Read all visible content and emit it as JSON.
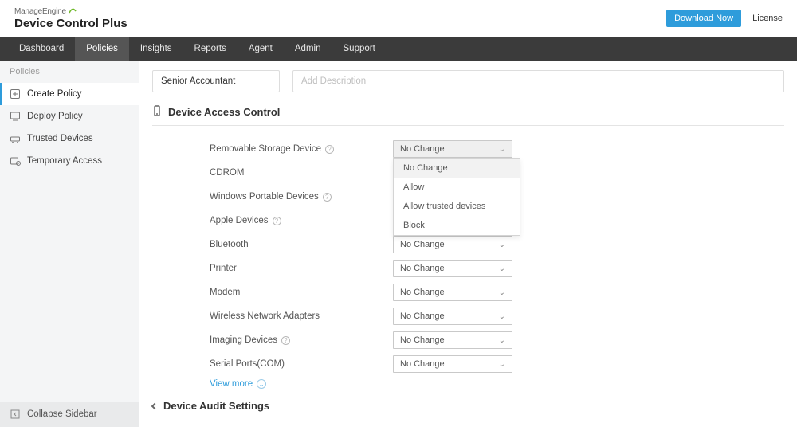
{
  "header": {
    "logo_small": "ManageEngine",
    "logo_big": "Device Control Plus",
    "download": "Download Now",
    "license": "License"
  },
  "nav": {
    "items": [
      {
        "label": "Dashboard"
      },
      {
        "label": "Policies",
        "active": true
      },
      {
        "label": "Insights"
      },
      {
        "label": "Reports"
      },
      {
        "label": "Agent"
      },
      {
        "label": "Admin"
      },
      {
        "label": "Support"
      }
    ]
  },
  "sidebar": {
    "header": "Policies",
    "items": [
      {
        "label": "Create Policy",
        "icon": "create",
        "active": true
      },
      {
        "label": "Deploy Policy",
        "icon": "deploy"
      },
      {
        "label": "Trusted Devices",
        "icon": "trusted"
      },
      {
        "label": "Temporary Access",
        "icon": "temp"
      }
    ],
    "collapse": "Collapse Sidebar"
  },
  "policy_form": {
    "name_value": "Senior Accountant",
    "desc_placeholder": "Add Description"
  },
  "section": {
    "access_control": "Device Access Control",
    "audit_settings": "Device Audit Settings"
  },
  "dropdown_open_index": 0,
  "dropdown_options": [
    "No Change",
    "Allow",
    "Allow trusted devices",
    "Block"
  ],
  "controls": [
    {
      "label": "Removable Storage Device",
      "help": true,
      "value": "No Change",
      "open": true
    },
    {
      "label": "CDROM",
      "value": ""
    },
    {
      "label": "Windows Portable Devices",
      "help": true,
      "value": ""
    },
    {
      "label": "Apple Devices",
      "help": true,
      "value": ""
    },
    {
      "label": "Bluetooth",
      "value": "No Change"
    },
    {
      "label": "Printer",
      "value": "No Change"
    },
    {
      "label": "Modem",
      "value": "No Change"
    },
    {
      "label": "Wireless Network Adapters",
      "value": "No Change"
    },
    {
      "label": "Imaging Devices",
      "help": true,
      "value": "No Change"
    },
    {
      "label": "Serial Ports(COM)",
      "value": "No Change"
    }
  ],
  "view_more": "View more"
}
